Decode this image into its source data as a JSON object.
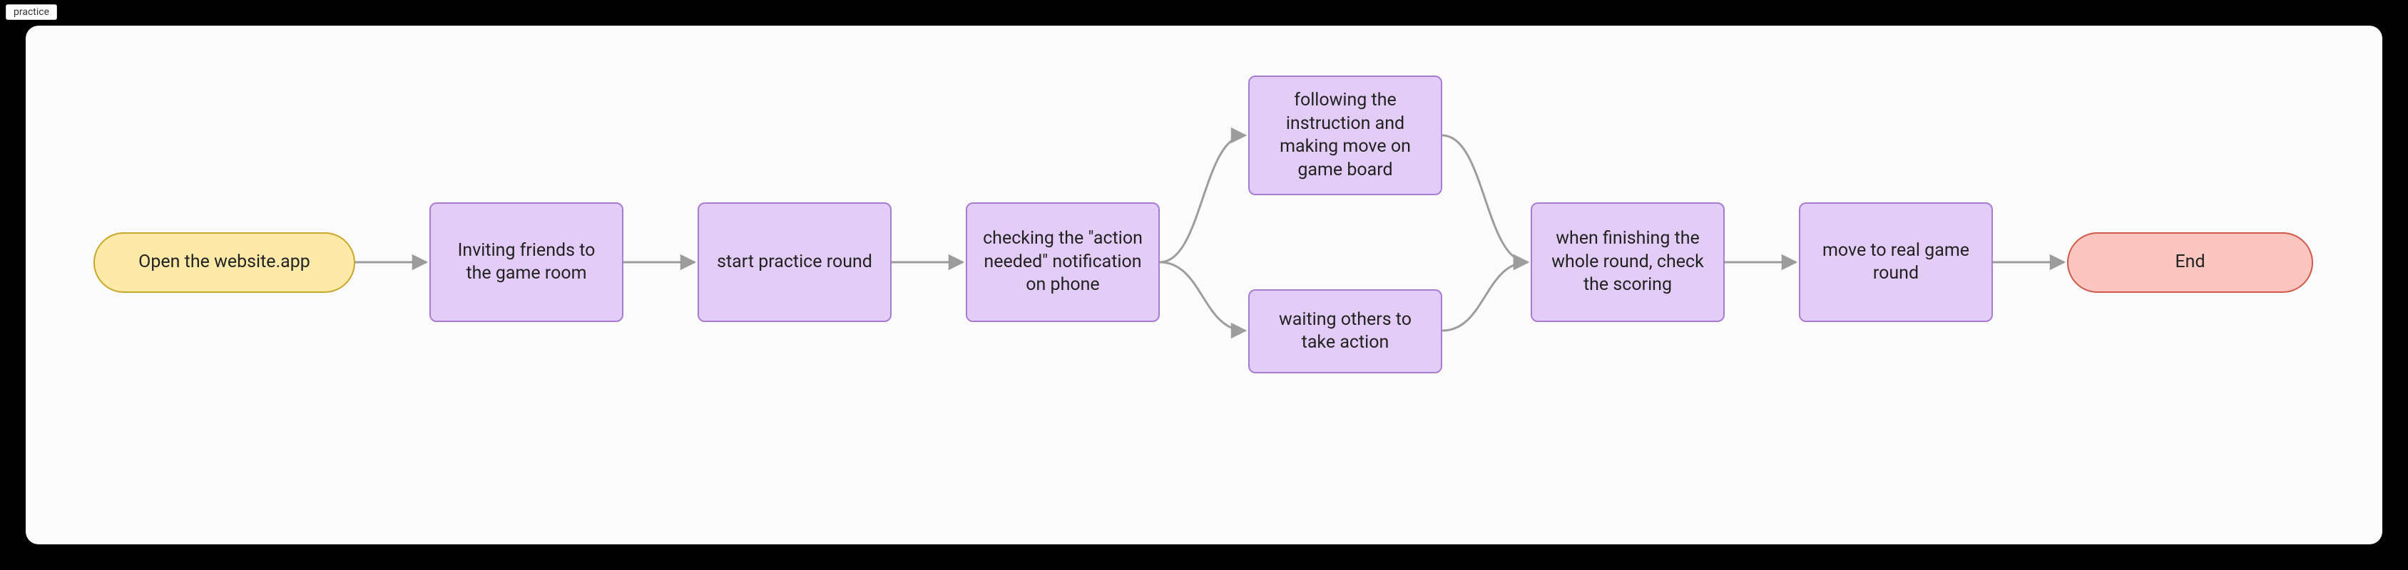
{
  "tab": {
    "label": "practice"
  },
  "nodes": {
    "start": {
      "text": "Open the website.app"
    },
    "inviting": {
      "text": "Inviting friends to the game room"
    },
    "startPractice": {
      "text": "start practice round"
    },
    "checking": {
      "text": "checking the \"action needed\" notification on phone"
    },
    "following": {
      "text": "following the instruction and making move on game board"
    },
    "waiting": {
      "text": "waiting others to take action"
    },
    "finishing": {
      "text": "when finishing the whole round, check the scoring"
    },
    "moveReal": {
      "text": "move to real game round"
    },
    "end": {
      "text": "End"
    }
  }
}
